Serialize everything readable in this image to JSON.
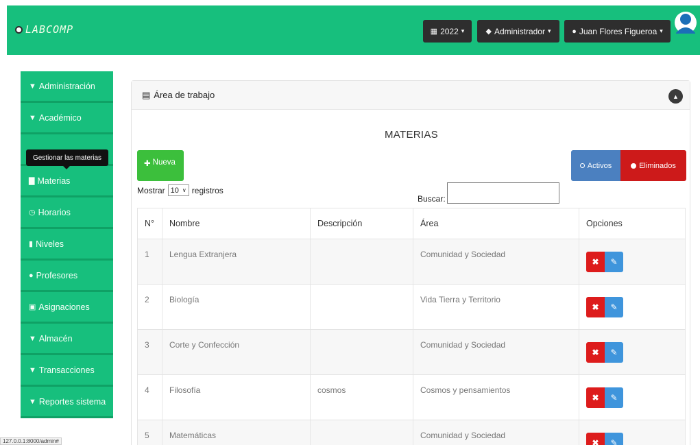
{
  "header": {
    "brand": "LABCOMP",
    "year_button": "2022",
    "role_button": "Administrador",
    "user_button": "Juan Flores Figueroa"
  },
  "sidebar": {
    "items": [
      {
        "label": "Administración",
        "icon": "chevron-down-icon"
      },
      {
        "label": "Académico",
        "icon": "chevron-down-icon"
      },
      {
        "label": "Materias",
        "icon": "book-icon"
      },
      {
        "label": "Horarios",
        "icon": "clock-icon"
      },
      {
        "label": "Niveles",
        "icon": "bookmark-icon"
      },
      {
        "label": "Profesores",
        "icon": "user-icon"
      },
      {
        "label": "Asignaciones",
        "icon": "contact-icon"
      },
      {
        "label": "Almacén",
        "icon": "chevron-down-icon"
      },
      {
        "label": "Transacciones",
        "icon": "chevron-down-icon"
      },
      {
        "label": "Reportes sistema",
        "icon": "chevron-down-icon"
      }
    ],
    "tooltip": "Gestionar las materias"
  },
  "status_url": "127.0.0.1:8000/admin#",
  "panel": {
    "title": "Área de trabajo",
    "heading": "MATERIAS",
    "new_button": "Nueva",
    "active_button": "Activos",
    "deleted_button": "Eliminados",
    "show_label": "Mostrar",
    "show_value": "10",
    "records_label": "registros",
    "search_label": "Buscar:"
  },
  "table": {
    "headers": [
      "N°",
      "Nombre",
      "Descripción",
      "Área",
      "Opciones"
    ],
    "rows": [
      {
        "n": "1",
        "nombre": "Lengua Extranjera",
        "descripcion": "",
        "area": "Comunidad y Sociedad"
      },
      {
        "n": "2",
        "nombre": "Biología",
        "descripcion": "",
        "area": "Vida Tierra y Territorio"
      },
      {
        "n": "3",
        "nombre": "Corte y Confección",
        "descripcion": "",
        "area": "Comunidad y Sociedad"
      },
      {
        "n": "4",
        "nombre": "Filosofía",
        "descripcion": "cosmos",
        "area": "Cosmos y pensamientos"
      },
      {
        "n": "5",
        "nombre": "Matemáticas",
        "descripcion": "",
        "area": "Comunidad y Sociedad"
      }
    ]
  },
  "colors": {
    "brand_green": "#17bf7d",
    "dark_button": "#2e2e2e",
    "danger": "#dd1c1c",
    "primary": "#3f95dc"
  }
}
